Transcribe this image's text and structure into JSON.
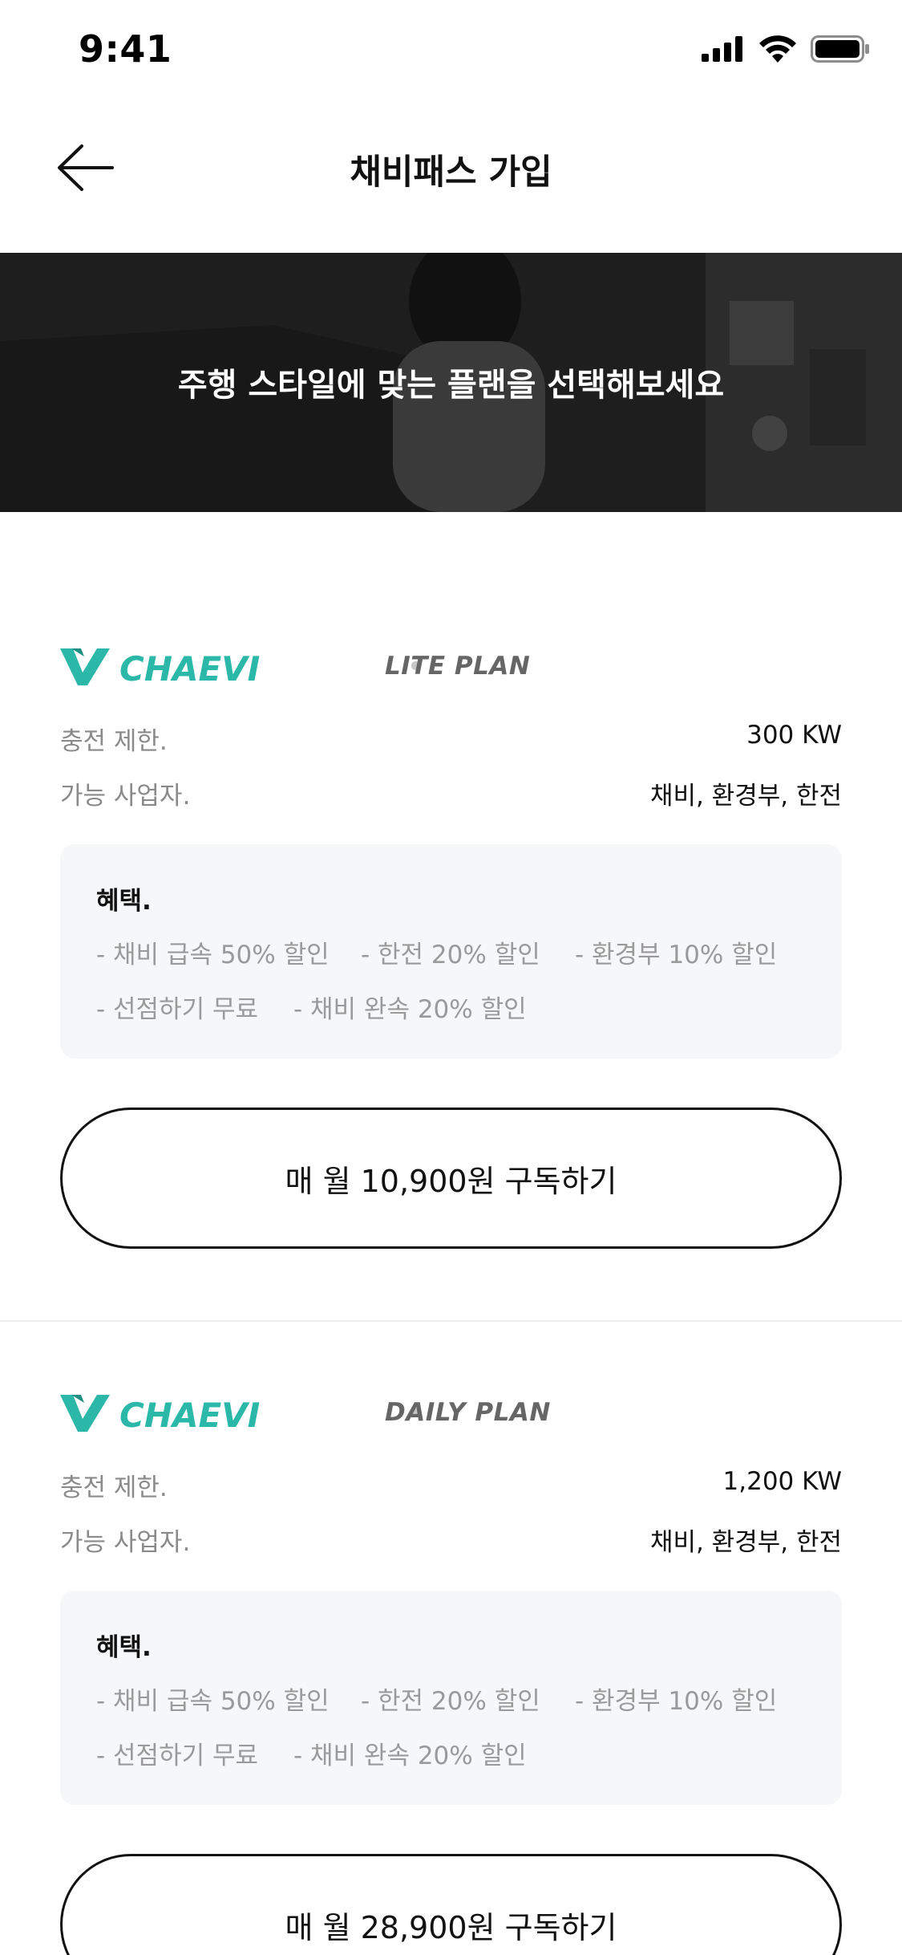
{
  "status_bar": {
    "time": "9:41"
  },
  "header": {
    "title": "채비패스 가입"
  },
  "banner": {
    "text": "주행 스타일에 맞는 플랜을 선택해보세요"
  },
  "brand": {
    "name": "CHAEVI",
    "color": "#2bb8a8"
  },
  "plans": [
    {
      "plan_name": "LITE PLAN",
      "charge_limit_label": "충전 제한.",
      "charge_limit_value": "300 KW",
      "providers_label": "가능 사업자.",
      "providers_value": "채비, 환경부, 한전",
      "benefits_title": "혜택.",
      "benefits": [
        "- 채비 급속 50% 할인",
        "- 한전 20% 할인",
        "- 환경부 10% 할인",
        "- 선점하기 무료",
        "- 채비 완속 20% 할인"
      ],
      "button_label": "매 월 10,900원 구독하기"
    },
    {
      "plan_name": "DAILY PLAN",
      "charge_limit_label": "충전 제한.",
      "charge_limit_value": "1,200 KW",
      "providers_label": "가능 사업자.",
      "providers_value": "채비, 환경부, 한전",
      "benefits_title": "혜택.",
      "benefits": [
        "- 채비 급속 50% 할인",
        "- 한전 20% 할인",
        "- 환경부 10% 할인",
        "- 선점하기 무료",
        "- 채비 완속 20% 할인"
      ],
      "button_label": "매 월 28,900원 구독하기"
    }
  ],
  "icons": {
    "back": "arrow-left-icon",
    "signal": "signal-icon",
    "wifi": "wifi-icon",
    "battery": "battery-icon"
  }
}
